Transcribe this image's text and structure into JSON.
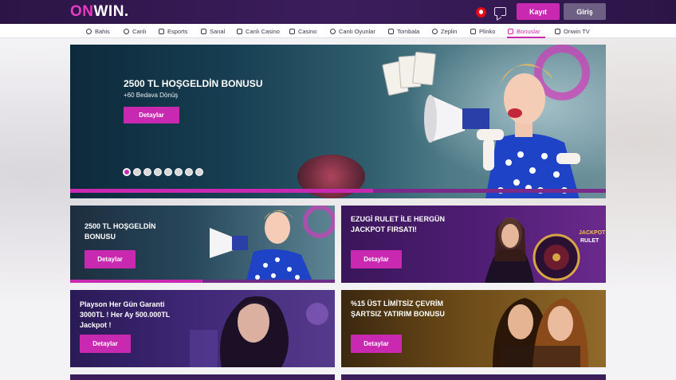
{
  "header": {
    "logo_on": "ON",
    "logo_win": "WIN.",
    "register_label": "Kayıt",
    "login_label": "Giriş"
  },
  "nav": {
    "items": [
      {
        "label": "Bahis",
        "icon": "soccer-ball-icon"
      },
      {
        "label": "Canlı",
        "icon": "live-icon"
      },
      {
        "label": "Esports",
        "icon": "gamepad-icon"
      },
      {
        "label": "Sanal",
        "icon": "virtual-icon"
      },
      {
        "label": "Canlı Casino",
        "icon": "casino-chip-icon"
      },
      {
        "label": "Casino",
        "icon": "slot-icon"
      },
      {
        "label": "Canlı Oyunlar",
        "icon": "live-games-icon"
      },
      {
        "label": "Tombala",
        "icon": "bingo-icon"
      },
      {
        "label": "Zeplin",
        "icon": "zeppelin-icon"
      },
      {
        "label": "Plinko",
        "icon": "triangle-icon"
      },
      {
        "label": "Bonuslar",
        "icon": "megaphone-icon"
      },
      {
        "label": "Onwin TV",
        "icon": "tv-icon"
      }
    ],
    "active": "Bonuslar"
  },
  "hero": {
    "title": "2500 TL HOŞGELDİN BONUSU",
    "subtitle": "+60 Bedava Dönüş",
    "cta": "Detaylar",
    "slide_count": 8,
    "active_slide": 1
  },
  "promos": [
    {
      "title_line1": "2500 TL HOŞGELDİN",
      "title_line2": "BONUSU",
      "title_line3": "",
      "cta": "Detaylar"
    },
    {
      "title_line1": "EZUGİ RULET İLE HERGÜN",
      "title_line2": "JACKPOT FIRSATI!",
      "title_line3": "",
      "cta": "Detaylar"
    },
    {
      "title_line1": "Playson Her Gün Garanti",
      "title_line2": "3000TL ! Her Ay 500.000TL",
      "title_line3": "Jackpot !",
      "cta": "Detaylar"
    },
    {
      "title_line1": "%15 ÜST LİMİTSİZ ÇEVRİM",
      "title_line2": "ŞARTSIZ YATIRIM BONUSU",
      "title_line3": "",
      "cta": "Detaylar"
    }
  ],
  "colors": {
    "brand": "#c928b0",
    "header_bg": "#2c1546",
    "login_bg": "#6e6085"
  }
}
